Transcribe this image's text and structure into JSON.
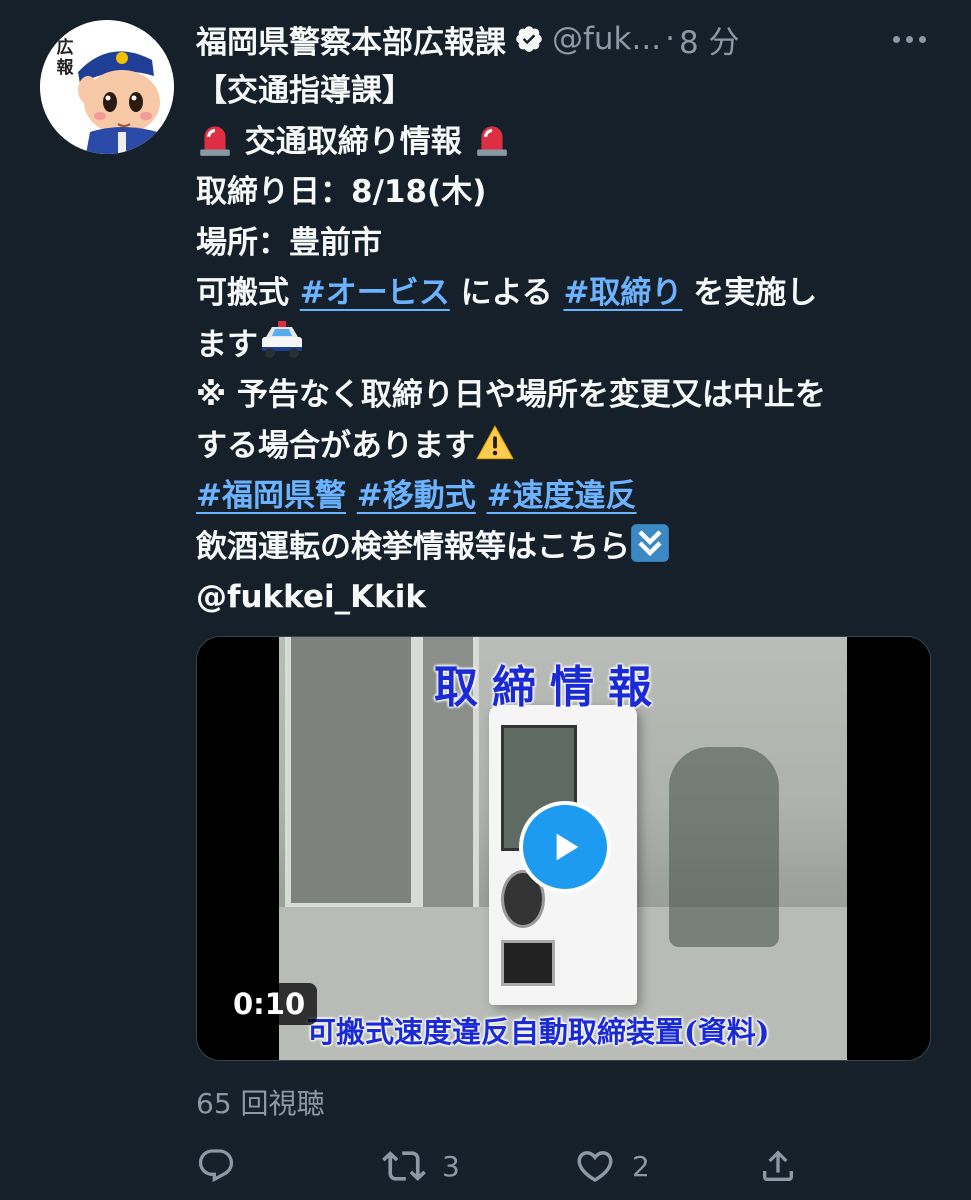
{
  "user": {
    "display_name": "福岡県警察本部広報課",
    "handle": "@fuk...",
    "separator": "·",
    "time": "8 分",
    "avatar_badge": "広報"
  },
  "tweet": {
    "line1": "【交通指導課】",
    "line2_text": "交通取締り情報",
    "line3": "取締り日：8/18(木)",
    "line4": "場所：豊前市",
    "line5_pre": "可搬式 ",
    "line5_tag1": "#オービス",
    "line5_mid": " による ",
    "line5_tag2": "#取締り",
    "line5_post": " を実施し",
    "line6": "ます",
    "line7": "※ 予告なく取締り日や場所を変更又は中止を",
    "line8": "する場合があります",
    "tags": [
      "#福岡県警",
      "#移動式",
      "#速度違反"
    ],
    "line10": "飲酒運転の検挙情報等はこちら",
    "line11": "@fukkei_Kkik"
  },
  "video": {
    "overlay_title": "取締情報",
    "overlay_caption": "可搬式速度違反自動取締装置(資料)",
    "duration": "0:10"
  },
  "stats": {
    "views": "65 回視聴",
    "retweets": "3",
    "likes": "2"
  },
  "icons": {
    "verified": "verified-badge-icon",
    "more": "more-icon",
    "siren": "siren-icon",
    "police_car": "police-car-icon",
    "warning": "warning-icon",
    "double_down": "double-down-arrow-icon",
    "play": "play-icon",
    "reply": "reply-icon",
    "retweet": "retweet-icon",
    "like": "like-icon",
    "share": "share-icon"
  },
  "colors": {
    "background": "#15202b",
    "text": "#f7f9f9",
    "muted": "#8b98a5",
    "link": "#6cb3ff",
    "accent": "#1d9bf0"
  }
}
